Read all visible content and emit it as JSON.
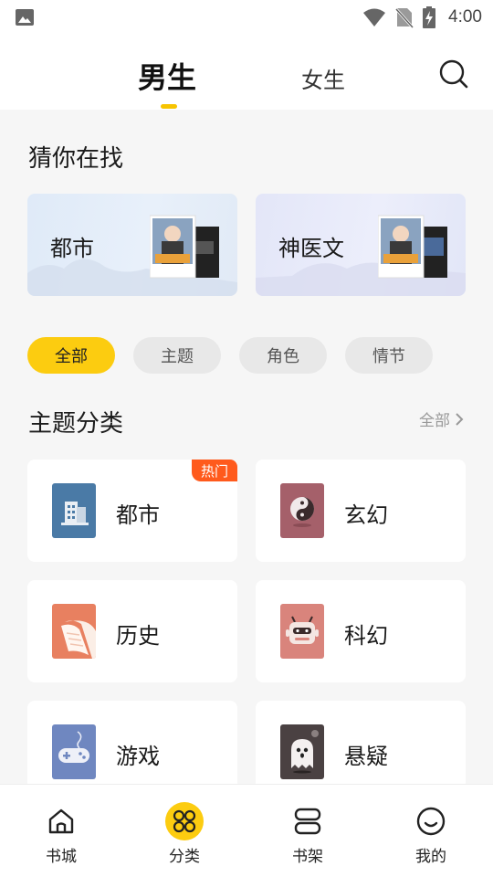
{
  "status_bar": {
    "time": "4:00"
  },
  "top_tabs": {
    "male": "男生",
    "female": "女生"
  },
  "guess": {
    "title": "猜你在找",
    "cards": [
      {
        "label": "都市"
      },
      {
        "label": "神医文"
      }
    ]
  },
  "filter_chips": [
    {
      "label": "全部",
      "active": true
    },
    {
      "label": "主题",
      "active": false
    },
    {
      "label": "角色",
      "active": false
    },
    {
      "label": "情节",
      "active": false
    }
  ],
  "theme": {
    "title": "主题分类",
    "all_link": "全部",
    "categories": [
      {
        "label": "都市",
        "icon": "city-building-icon",
        "color": "#4a7aa6",
        "badge": "热门"
      },
      {
        "label": "玄幻",
        "icon": "yin-yang-icon",
        "color": "#a5606a"
      },
      {
        "label": "历史",
        "icon": "scroll-icon",
        "color": "#e88060"
      },
      {
        "label": "科幻",
        "icon": "robot-icon",
        "color": "#d9847c"
      },
      {
        "label": "游戏",
        "icon": "gamepad-icon",
        "color": "#6f87c0"
      },
      {
        "label": "悬疑",
        "icon": "ghost-icon",
        "color": "#4a4142"
      }
    ]
  },
  "bottom_nav": [
    {
      "label": "书城",
      "icon": "home-icon"
    },
    {
      "label": "分类",
      "icon": "category-icon",
      "active": true
    },
    {
      "label": "书架",
      "icon": "bookshelf-icon"
    },
    {
      "label": "我的",
      "icon": "smiley-profile-icon"
    }
  ],
  "colors": {
    "accent": "#fccc10",
    "hot_badge": "#ff5a1c"
  }
}
